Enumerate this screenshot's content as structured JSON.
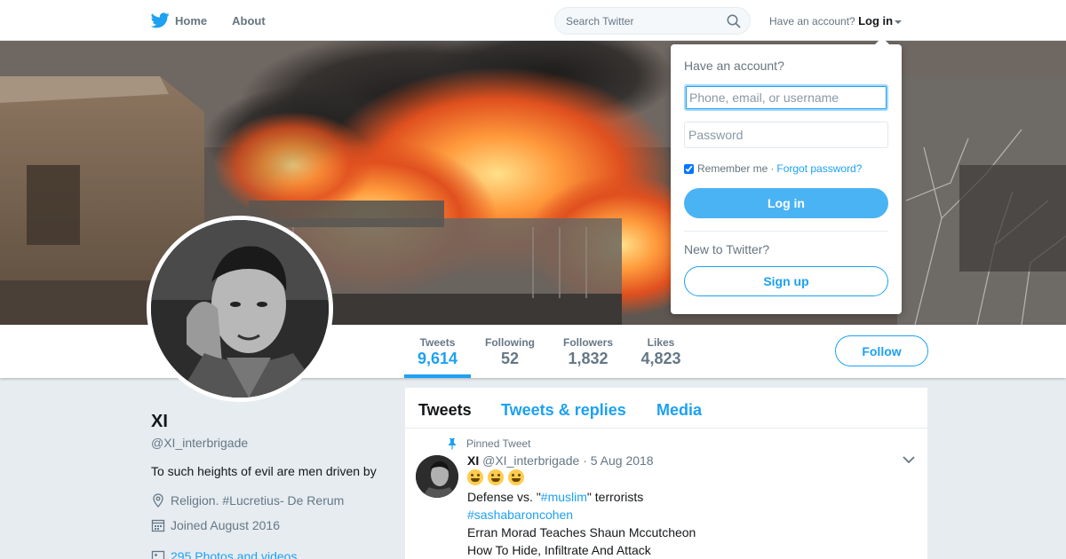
{
  "nav": {
    "home_label": "Home",
    "about_label": "About",
    "search_placeholder": "Search Twitter",
    "have_account": "Have an account?",
    "login_label": "Log in"
  },
  "profile": {
    "name": "XI",
    "handle": "@XI_interbrigade",
    "bio": "To such heights of evil are men driven by",
    "location": "Religion. #Lucretius- De Rerum",
    "joined": "Joined August 2016",
    "media_link": "295 Photos and videos"
  },
  "stats": [
    {
      "label": "Tweets",
      "value": "9,614"
    },
    {
      "label": "Following",
      "value": "52"
    },
    {
      "label": "Followers",
      "value": "1,832"
    },
    {
      "label": "Likes",
      "value": "4,823"
    }
  ],
  "follow_label": "Follow",
  "timeline": {
    "tabs": [
      "Tweets",
      "Tweets & replies",
      "Media"
    ],
    "pinned_label": "Pinned Tweet",
    "tweet": {
      "name": "XI",
      "handle": "@XI_interbrigade",
      "separator": "·",
      "date": "5 Aug 2018",
      "line2_pre": "Defense vs. \"",
      "line2_tag": "#muslim",
      "line2_post": "\" terrorists",
      "line3_tag": "#sashabaroncohen",
      "line4": "Erran Morad Teaches Shaun Mccutcheon",
      "line5": "How To Hide, Infiltrate And Attack"
    }
  },
  "login": {
    "title": "Have an account?",
    "username_placeholder": "Phone, email, or username",
    "password_placeholder": "Password",
    "remember": "Remember me",
    "dot": "·",
    "forgot": "Forgot password?",
    "login_button": "Log in",
    "new_prompt": "New to Twitter?",
    "signup_button": "Sign up"
  },
  "colors": {
    "accent": "#1da1f2",
    "login_button": "#4ab3f4"
  }
}
